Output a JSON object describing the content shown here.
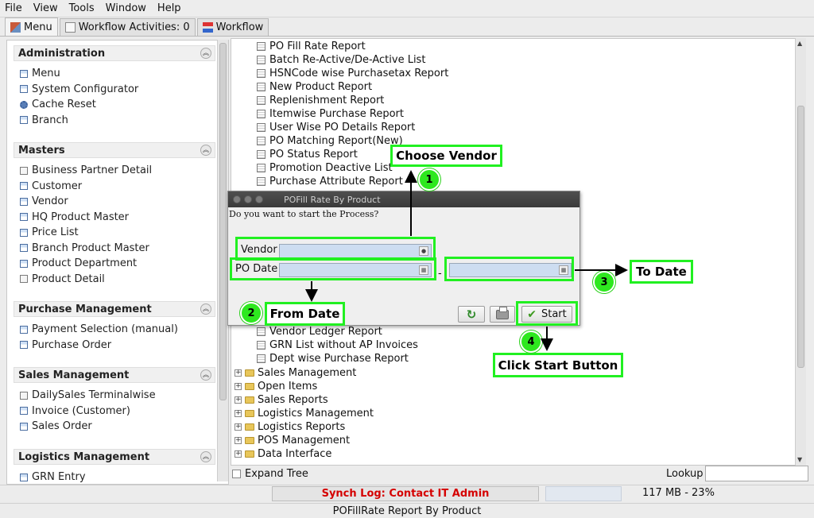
{
  "menu": {
    "file": "File",
    "view": "View",
    "tools": "Tools",
    "window": "Window",
    "help": "Help"
  },
  "tabs": [
    {
      "label": "Menu"
    },
    {
      "label": "Workflow Activities: 0"
    },
    {
      "label": "Workflow"
    }
  ],
  "left": {
    "administration": {
      "title": "Administration",
      "items": [
        "Menu",
        "System Configurator",
        "Cache Reset",
        "Branch"
      ]
    },
    "masters": {
      "title": "Masters",
      "items": [
        "Business Partner Detail",
        "Customer",
        "Vendor",
        "HQ Product Master",
        "Price List",
        "Branch Product Master",
        "Product Department",
        "Product Detail"
      ]
    },
    "purchase": {
      "title": "Purchase Management",
      "items": [
        "Payment Selection (manual)",
        "Purchase Order"
      ]
    },
    "sales": {
      "title": "Sales Management",
      "items": [
        "DailySales Terminalwise",
        "Invoice (Customer)",
        "Sales Order"
      ]
    },
    "logistics": {
      "title": "Logistics Management",
      "items": [
        "GRN Entry"
      ]
    }
  },
  "tree": {
    "reports_top": [
      "PO Fill Rate Report",
      "Batch Re-Active/De-Active List",
      "HSNCode wise Purchasetax Report",
      "New Product Report",
      "Replenishment Report",
      "Itemwise Purchase Report",
      "User Wise PO Details Report",
      "PO Matching Report(New)",
      "PO Status Report",
      "Promotion Deactive List",
      "Purchase Attribute Report"
    ],
    "reports_bottom": [
      "Vendor Ledger Report",
      "GRN List without AP Invoices",
      "Dept wise Purchase Report"
    ],
    "folders": [
      "Sales Management",
      "Open Items",
      "Sales Reports",
      "Logistics Management",
      "Logistics Reports",
      "POS Management",
      "Data Interface"
    ]
  },
  "expand_tree": "Expand Tree",
  "lookup": "Lookup",
  "status": {
    "synch": "Synch Log: Contact IT Admin",
    "memory": "117 MB - 23%"
  },
  "footer": "POFillRate Report By Product",
  "dialog": {
    "title": "POFill Rate By Product",
    "question": "Do you want to start the Process?",
    "vendor_label": "Vendor",
    "podate_label": "PO Date",
    "separator": "-",
    "start_label": "Start"
  },
  "annotations": {
    "choose_vendor": "Choose Vendor",
    "from_date": "From Date",
    "to_date": "To Date",
    "click_start": "Click Start Button",
    "n1": "1",
    "n2": "2",
    "n3": "3",
    "n4": "4"
  },
  "colors": {
    "highlight": "#21f021",
    "status_error": "#d50000",
    "field_bg": "#cdddf1"
  }
}
